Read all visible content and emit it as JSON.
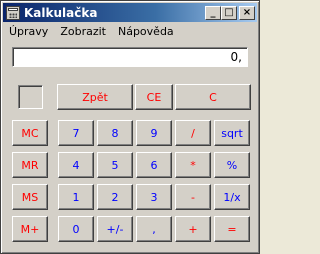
{
  "window": {
    "title": "Kalkulačka",
    "controls": {
      "minimize": "_",
      "maximize": "□",
      "close": "×"
    }
  },
  "menu": [
    "Úpravy",
    "Zobrazit",
    "Nápověda"
  ],
  "display": {
    "value": "0,"
  },
  "top_buttons": [
    "Zpět",
    "CE",
    "C"
  ],
  "memory_buttons": [
    "MC",
    "MR",
    "MS",
    "M+"
  ],
  "keypad": [
    [
      "7",
      "8",
      "9",
      "/",
      "sqrt"
    ],
    [
      "4",
      "5",
      "6",
      "*",
      "%"
    ],
    [
      "1",
      "2",
      "3",
      "-",
      "1/x"
    ],
    [
      "0",
      "+/-",
      ",",
      "+",
      "="
    ]
  ],
  "colors": {
    "titlebar": "#0a246a",
    "operator": "#ff0000",
    "digit": "#0000ff"
  }
}
